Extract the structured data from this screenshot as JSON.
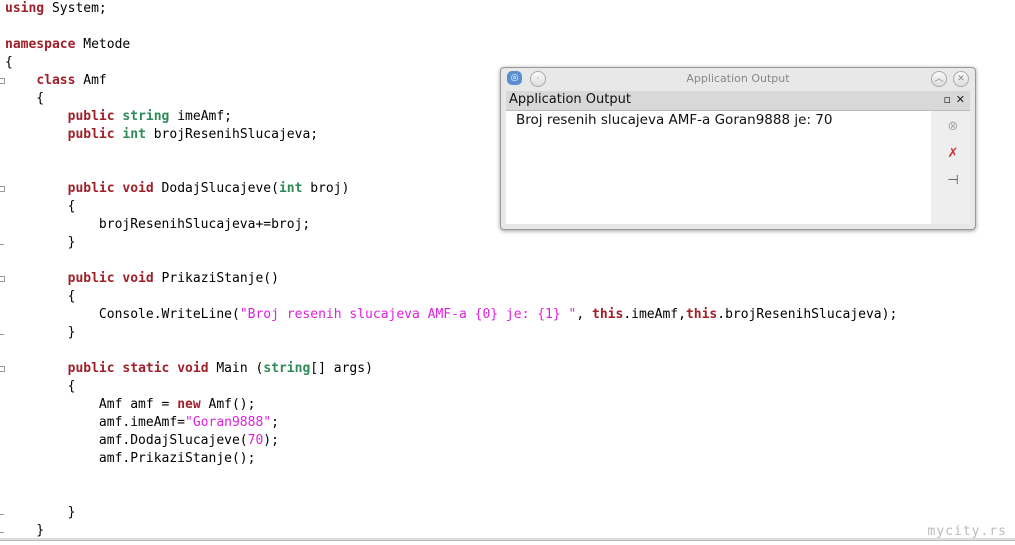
{
  "editor": {
    "lines": [
      {
        "fold": "",
        "tokens": [
          [
            "kw",
            "using"
          ],
          [
            "",
            " System;"
          ]
        ]
      },
      {
        "fold": "",
        "tokens": []
      },
      {
        "fold": "",
        "tokens": [
          [
            "kw",
            "namespace"
          ],
          [
            "",
            " Metode"
          ]
        ]
      },
      {
        "fold": "",
        "tokens": [
          [
            "",
            "{"
          ]
        ]
      },
      {
        "fold": "start",
        "tokens": [
          [
            "",
            "    "
          ],
          [
            "kw",
            "class"
          ],
          [
            "",
            " Amf"
          ]
        ]
      },
      {
        "fold": "",
        "tokens": [
          [
            "",
            "    {"
          ]
        ]
      },
      {
        "fold": "",
        "tokens": [
          [
            "",
            "        "
          ],
          [
            "kw",
            "public"
          ],
          [
            "",
            " "
          ],
          [
            "ty",
            "string"
          ],
          [
            "",
            " imeAmf;"
          ]
        ]
      },
      {
        "fold": "",
        "tokens": [
          [
            "",
            "        "
          ],
          [
            "kw",
            "public"
          ],
          [
            "",
            " "
          ],
          [
            "ty",
            "int"
          ],
          [
            "",
            " brojResenihSlucajeva;"
          ]
        ]
      },
      {
        "fold": "",
        "tokens": []
      },
      {
        "fold": "",
        "tokens": []
      },
      {
        "fold": "start",
        "tokens": [
          [
            "",
            "        "
          ],
          [
            "kw",
            "public"
          ],
          [
            "",
            " "
          ],
          [
            "kw",
            "void"
          ],
          [
            "",
            " DodajSlucajeve("
          ],
          [
            "ty",
            "int"
          ],
          [
            "",
            " broj)"
          ]
        ]
      },
      {
        "fold": "",
        "tokens": [
          [
            "",
            "        {"
          ]
        ]
      },
      {
        "fold": "",
        "tokens": [
          [
            "",
            "            brojResenihSlucajeva+=broj;"
          ]
        ]
      },
      {
        "fold": "end",
        "tokens": [
          [
            "",
            "        }"
          ]
        ]
      },
      {
        "fold": "",
        "tokens": []
      },
      {
        "fold": "start",
        "tokens": [
          [
            "",
            "        "
          ],
          [
            "kw",
            "public"
          ],
          [
            "",
            " "
          ],
          [
            "kw",
            "void"
          ],
          [
            "",
            " PrikaziStanje()"
          ]
        ]
      },
      {
        "fold": "",
        "tokens": [
          [
            "",
            "        {"
          ]
        ]
      },
      {
        "fold": "",
        "tokens": [
          [
            "",
            "            Console.WriteLine("
          ],
          [
            "st",
            "\"Broj resenih slucajeva AMF-a {0} je: {1} \""
          ],
          [
            "",
            ", "
          ],
          [
            "kw",
            "this"
          ],
          [
            "",
            ".imeAmf,"
          ],
          [
            "kw",
            "this"
          ],
          [
            "",
            ".brojResenihSlucajeva);"
          ]
        ]
      },
      {
        "fold": "end",
        "tokens": [
          [
            "",
            "        }"
          ]
        ]
      },
      {
        "fold": "",
        "tokens": []
      },
      {
        "fold": "start",
        "tokens": [
          [
            "",
            "        "
          ],
          [
            "kw",
            "public"
          ],
          [
            "",
            " "
          ],
          [
            "kw",
            "static"
          ],
          [
            "",
            " "
          ],
          [
            "kw",
            "void"
          ],
          [
            "",
            " Main ("
          ],
          [
            "ty",
            "string"
          ],
          [
            "",
            "[] args)"
          ]
        ]
      },
      {
        "fold": "",
        "tokens": [
          [
            "",
            "        {"
          ]
        ]
      },
      {
        "fold": "",
        "tokens": [
          [
            "",
            "            Amf amf = "
          ],
          [
            "kw",
            "new"
          ],
          [
            "",
            " Amf();"
          ]
        ]
      },
      {
        "fold": "",
        "tokens": [
          [
            "",
            "            amf.imeAmf="
          ],
          [
            "st",
            "\"Goran9888\""
          ],
          [
            "",
            ";"
          ]
        ]
      },
      {
        "fold": "",
        "tokens": [
          [
            "",
            "            amf.DodajSlucajeve("
          ],
          [
            "nu",
            "70"
          ],
          [
            "",
            ");"
          ]
        ]
      },
      {
        "fold": "",
        "tokens": [
          [
            "",
            "            amf.PrikaziStanje();"
          ]
        ]
      },
      {
        "fold": "",
        "tokens": []
      },
      {
        "fold": "",
        "tokens": []
      },
      {
        "fold": "end",
        "tokens": [
          [
            "",
            "        }"
          ]
        ]
      },
      {
        "fold": "end",
        "tokens": [
          [
            "",
            "    }"
          ]
        ]
      }
    ]
  },
  "window": {
    "title": "Application Output",
    "panel_title": "Application Output",
    "output": "Broj resenih slucajeva AMF-a Goran9888 je: 70"
  },
  "watermark": "mycity.rs"
}
